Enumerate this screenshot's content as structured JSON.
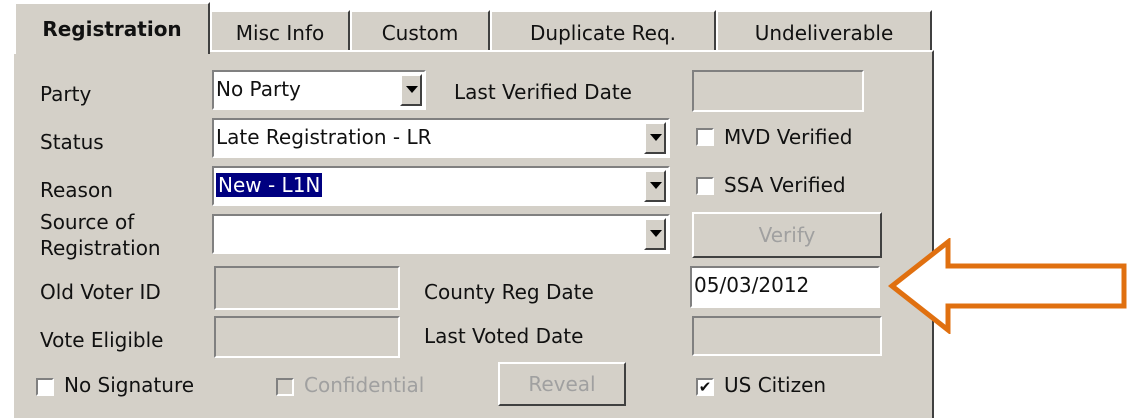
{
  "tabs": [
    "Registration",
    "Misc Info",
    "Custom",
    "Duplicate Req.",
    "Undeliverable"
  ],
  "labels": {
    "party": "Party",
    "last_verified_date": "Last Verified Date",
    "status": "Status",
    "reason": "Reason",
    "source_line1": "Source of",
    "source_line2": "Registration",
    "old_voter_id": "Old Voter ID",
    "county_reg_date": "County Reg Date",
    "vote_eligible": "Vote Eligible",
    "last_voted_date": "Last Voted Date"
  },
  "fields": {
    "party": "No Party",
    "last_verified_date": "",
    "status": "Late Registration - LR",
    "reason": "New - L1N",
    "source_of_registration": "",
    "old_voter_id": "",
    "county_reg_date": "05/03/2012",
    "vote_eligible": "",
    "last_voted_date": ""
  },
  "checkboxes": {
    "mvd_verified": {
      "label": "MVD Verified",
      "checked": false,
      "mark": ""
    },
    "ssa_verified": {
      "label": "SSA Verified",
      "checked": false,
      "mark": ""
    },
    "no_signature": {
      "label": "No Signature",
      "checked": false,
      "mark": ""
    },
    "confidential": {
      "label": "Confidential",
      "checked": false,
      "mark": ""
    },
    "us_citizen": {
      "label": "US Citizen",
      "checked": true,
      "mark": "✔"
    }
  },
  "buttons": {
    "verify": "Verify",
    "reveal": "Reveal"
  },
  "colors": {
    "panel": "#d4d0c8",
    "selection": "#000080",
    "annotation_arrow": "#e07010"
  },
  "icons": {
    "dropdown": "chevron-down-icon",
    "annotation": "arrow-left-icon"
  }
}
